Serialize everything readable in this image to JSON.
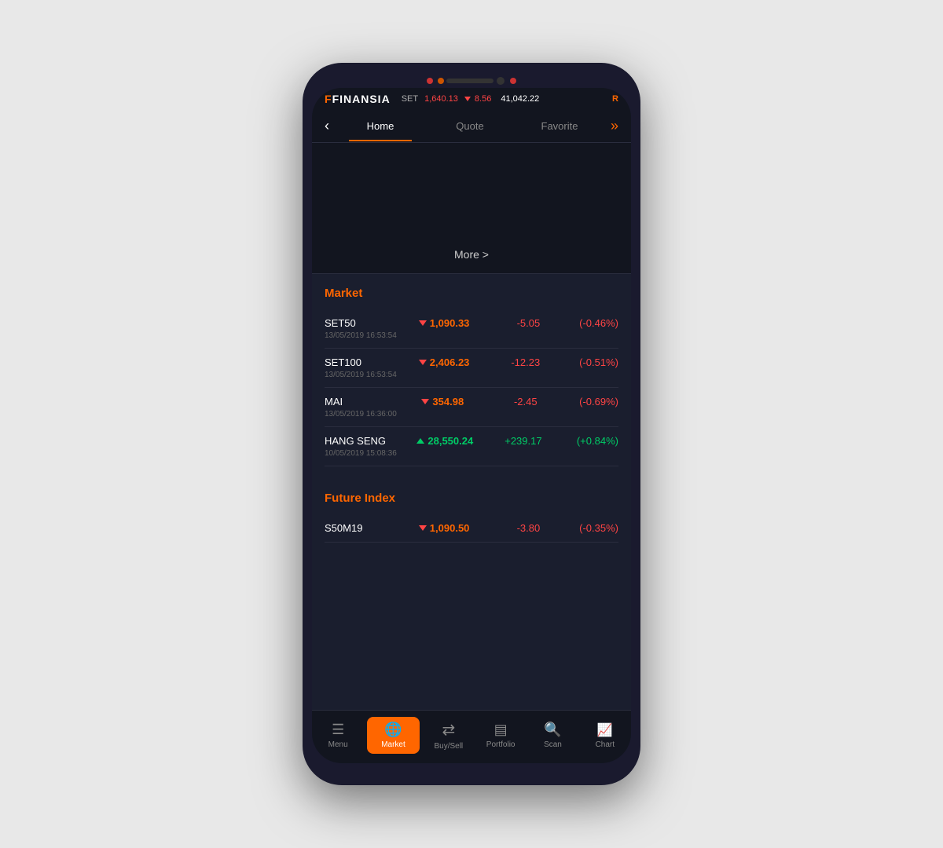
{
  "app": {
    "logo_text": "FINANSIA",
    "logo_prefix": "F"
  },
  "statusbar": {
    "set_label": "SET",
    "set_price": "1,640.13",
    "set_change": "8.56",
    "set_total": "41,042.22",
    "user_icon": "R"
  },
  "nav": {
    "back_icon": "‹",
    "tabs": [
      {
        "label": "Home",
        "active": true
      },
      {
        "label": "Quote",
        "active": false
      },
      {
        "label": "Favorite",
        "active": false
      }
    ],
    "more_icon": "»"
  },
  "more_button": {
    "label": "More >"
  },
  "market": {
    "title": "Market",
    "items": [
      {
        "name": "SET50",
        "direction": "down",
        "price": "1,090.33",
        "change": "-5.05",
        "pct": "(-0.46%)",
        "timestamp": "13/05/2019  16:53:54",
        "positive": false
      },
      {
        "name": "SET100",
        "direction": "down",
        "price": "2,406.23",
        "change": "-12.23",
        "pct": "(-0.51%)",
        "timestamp": "13/05/2019  16:53:54",
        "positive": false
      },
      {
        "name": "MAI",
        "direction": "down",
        "price": "354.98",
        "change": "-2.45",
        "pct": "(-0.69%)",
        "timestamp": "13/05/2019  16:36:00",
        "positive": false
      },
      {
        "name": "HANG SENG",
        "direction": "up",
        "price": "28,550.24",
        "change": "+239.17",
        "pct": "(+0.84%)",
        "timestamp": "10/05/2019  15:08:36",
        "positive": true
      }
    ]
  },
  "future_index": {
    "title": "Future Index",
    "items": [
      {
        "name": "S50M19",
        "direction": "down",
        "price": "1,090.50",
        "change": "-3.80",
        "pct": "(-0.35%)",
        "timestamp": "",
        "positive": false
      }
    ]
  },
  "bottom_nav": {
    "items": [
      {
        "label": "Menu",
        "icon": "☰",
        "active": false
      },
      {
        "label": "Market",
        "icon": "🌐",
        "active": true
      },
      {
        "label": "Buy/Sell",
        "icon": "⇄",
        "active": false
      },
      {
        "label": "Portfolio",
        "icon": "▤",
        "active": false
      },
      {
        "label": "Scan",
        "icon": "🔍",
        "active": false
      },
      {
        "label": "Chart",
        "icon": "📈",
        "active": false
      }
    ]
  }
}
